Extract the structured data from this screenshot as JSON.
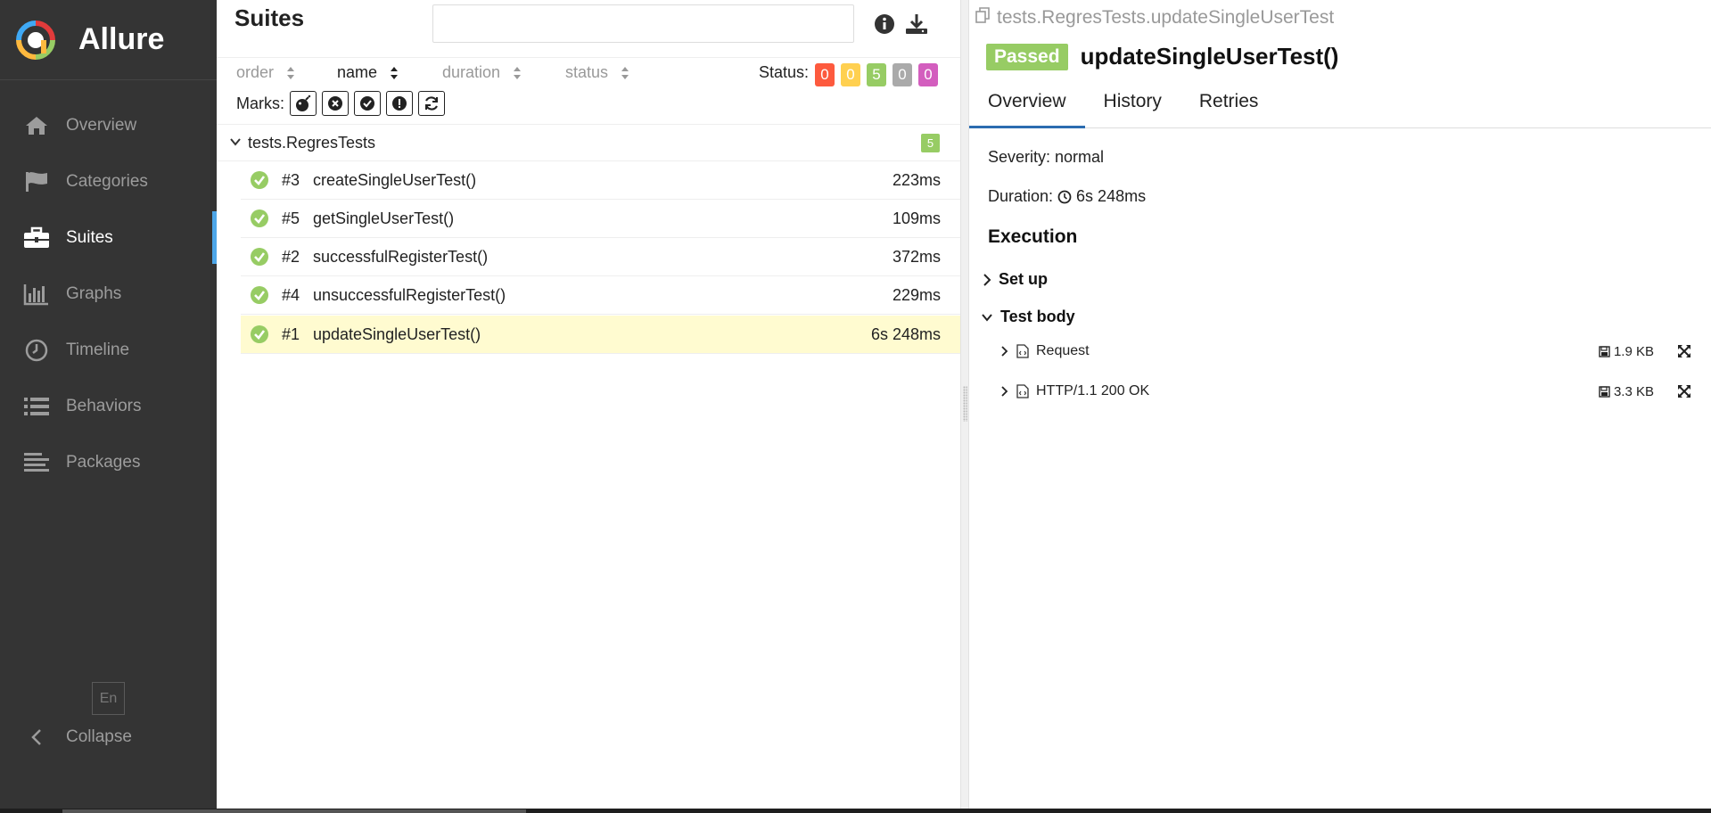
{
  "app": {
    "brand": "Allure"
  },
  "sidebar": {
    "items": [
      {
        "label": "Overview",
        "icon": "home-icon",
        "active": false
      },
      {
        "label": "Categories",
        "icon": "flag-icon",
        "active": false
      },
      {
        "label": "Suites",
        "icon": "briefcase-icon",
        "active": true
      },
      {
        "label": "Graphs",
        "icon": "bar-chart-icon",
        "active": false
      },
      {
        "label": "Timeline",
        "icon": "clock-icon",
        "active": false
      },
      {
        "label": "Behaviors",
        "icon": "list-icon",
        "active": false
      },
      {
        "label": "Packages",
        "icon": "align-left-icon",
        "active": false
      }
    ],
    "language": "En",
    "collapse_label": "Collapse"
  },
  "suites": {
    "title": "Suites",
    "search_value": "",
    "sort": {
      "order": "order",
      "name": "name",
      "duration": "duration",
      "status": "status"
    },
    "status_label": "Status:",
    "status_counts": [
      {
        "key": "failed",
        "count": "0",
        "color": "#fd5a3e"
      },
      {
        "key": "broken",
        "count": "0",
        "color": "#ffd050"
      },
      {
        "key": "passed",
        "count": "5",
        "color": "#97cc64"
      },
      {
        "key": "skipped",
        "count": "0",
        "color": "#aaaaaa"
      },
      {
        "key": "unknown",
        "count": "0",
        "color": "#d35ebe"
      }
    ],
    "marks_label": "Marks:",
    "group": {
      "name": "tests.RegresTests",
      "count": "5"
    },
    "tests": [
      {
        "num": "#3",
        "name": "createSingleUserTest()",
        "duration": "223ms",
        "status": "passed"
      },
      {
        "num": "#5",
        "name": "getSingleUserTest()",
        "duration": "109ms",
        "status": "passed"
      },
      {
        "num": "#2",
        "name": "successfulRegisterTest()",
        "duration": "372ms",
        "status": "passed"
      },
      {
        "num": "#4",
        "name": "unsuccessfulRegisterTest()",
        "duration": "229ms",
        "status": "passed"
      },
      {
        "num": "#1",
        "name": "updateSingleUserTest()",
        "duration": "6s 248ms",
        "status": "passed",
        "selected": true
      }
    ]
  },
  "detail": {
    "path": "tests.RegresTests.updateSingleUserTest",
    "status_badge": "Passed",
    "title": "updateSingleUserTest()",
    "tabs": [
      "Overview",
      "History",
      "Retries"
    ],
    "severity": "Severity: normal",
    "duration_label": "Duration:",
    "duration_value": "6s 248ms",
    "execution_title": "Execution",
    "setup_label": "Set up",
    "body_label": "Test body",
    "attachments": [
      {
        "name": "Request",
        "size": "1.9 KB"
      },
      {
        "name": "HTTP/1.1 200 OK",
        "size": "3.3 KB"
      }
    ]
  }
}
